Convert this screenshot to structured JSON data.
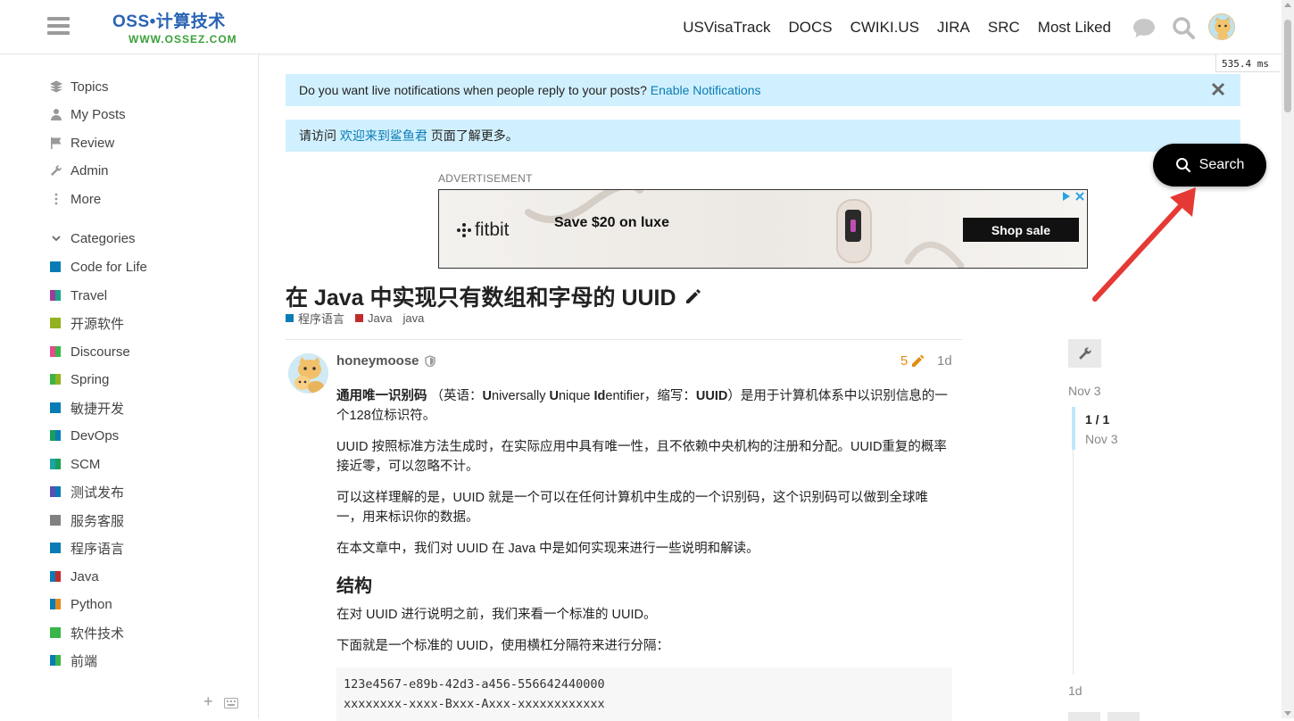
{
  "header": {
    "logo_top": "OSS•计算技术",
    "logo_bottom": "WWW.OSSEZ.COM",
    "links": [
      "USVisaTrack",
      "DOCS",
      "CWIKI.US",
      "JIRA",
      "SRC",
      "Most Liked"
    ],
    "timing": "535.4 ms"
  },
  "sidebar": {
    "nav": [
      {
        "label": "Topics",
        "icon": "layers-icon"
      },
      {
        "label": "My Posts",
        "icon": "user-icon"
      },
      {
        "label": "Review",
        "icon": "flag-icon"
      },
      {
        "label": "Admin",
        "icon": "wrench-icon"
      },
      {
        "label": "More",
        "icon": "ellipsis-vertical-icon"
      }
    ],
    "categories_label": "Categories",
    "categories": [
      {
        "label": "Code for Life",
        "colors": [
          "#0a7cb5",
          "#0a7cb5"
        ]
      },
      {
        "label": "Travel",
        "colors": [
          "#9b3d9a",
          "#1ea38a"
        ]
      },
      {
        "label": "开源软件",
        "colors": [
          "#94b11f",
          "#94b11f"
        ]
      },
      {
        "label": "Discourse",
        "colors": [
          "#e44b8d",
          "#3ab549"
        ]
      },
      {
        "label": "Spring",
        "colors": [
          "#3ab549",
          "#94b11f"
        ]
      },
      {
        "label": "敏捷开发",
        "colors": [
          "#0a7cb5",
          "#0a7cb5"
        ]
      },
      {
        "label": "DevOps",
        "colors": [
          "#1a9e5a",
          "#0a7cb5"
        ]
      },
      {
        "label": "SCM",
        "colors": [
          "#1aa5a5",
          "#1a9e5a"
        ]
      },
      {
        "label": "测试发布",
        "colors": [
          "#5b4fb5",
          "#0a7cb5"
        ]
      },
      {
        "label": "服务客服",
        "colors": [
          "#808281",
          "#808281"
        ]
      },
      {
        "label": "程序语言",
        "colors": [
          "#0a7cb5",
          "#0a7cb5"
        ]
      },
      {
        "label": "Java",
        "colors": [
          "#0a7cb5",
          "#c02b2b"
        ]
      },
      {
        "label": "Python",
        "colors": [
          "#0a7cb5",
          "#e08a1e"
        ]
      },
      {
        "label": "软件技术",
        "colors": [
          "#3ab549",
          "#3ab549"
        ]
      },
      {
        "label": "前端",
        "colors": [
          "#0a7cb5",
          "#3ab549"
        ]
      }
    ]
  },
  "banners": {
    "notify_text": "Do you want live notifications when people reply to your posts?",
    "notify_link": "Enable Notifications",
    "visit_prefix": "请访问",
    "visit_link": "欢迎来到鲨鱼君",
    "visit_suffix": "页面了解更多。"
  },
  "ad": {
    "label": "ADVERTISEMENT",
    "brand": "fitbit",
    "headline": "Save $20 on luxe",
    "cta": "Shop sale"
  },
  "topic": {
    "title": "在 Java 中实现只有数组和字母的 UUID",
    "categories": [
      {
        "label": "程序语言",
        "color": "#0a7cb5"
      },
      {
        "label": "Java",
        "color": "#c02b2b"
      }
    ],
    "tag": "java"
  },
  "post": {
    "author": "honeymoose",
    "edits": "5",
    "date": "1d",
    "p1_pre": "（英语：",
    "p1_term": "通用唯一识别码",
    "p1_u1": "U",
    "p1_r1": "niversally ",
    "p1_u2": "U",
    "p1_r2": "nique ",
    "p1_u3": "Id",
    "p1_r3": "entifier，缩写：",
    "p1_abbr": "UUID",
    "p1_post": "）是用于计算机体系中以识别信息的一个128位标识符。",
    "p2": "UUID 按照标准方法生成时，在实际应用中具有唯一性，且不依赖中央机构的注册和分配。UUID重复的概率接近零，可以忽略不计。",
    "p3": "可以这样理解的是，UUID 就是一个可以在任何计算机中生成的一个识别码，这个识别码可以做到全球唯一，用来标识你的数据。",
    "p4": "在本文章中，我们对 UUID 在 Java 中是如何实现来进行一些说明和解读。",
    "h2": "结构",
    "p5": "在对 UUID 进行说明之前，我们来看一个标准的 UUID。",
    "p6": "下面就是一个标准的 UUID，使用横杠分隔符来进行分隔：",
    "code_line1": "123e4567-e89b-42d3-a456-556642440000",
    "code_line2": "xxxxxxxx-xxxx-Bxxx-Axxx-xxxxxxxxxxxx"
  },
  "timeline": {
    "start": "Nov 3",
    "count": "1 / 1",
    "count_date": "Nov 3",
    "end": "1d"
  },
  "floating_search": {
    "label": "Search"
  }
}
